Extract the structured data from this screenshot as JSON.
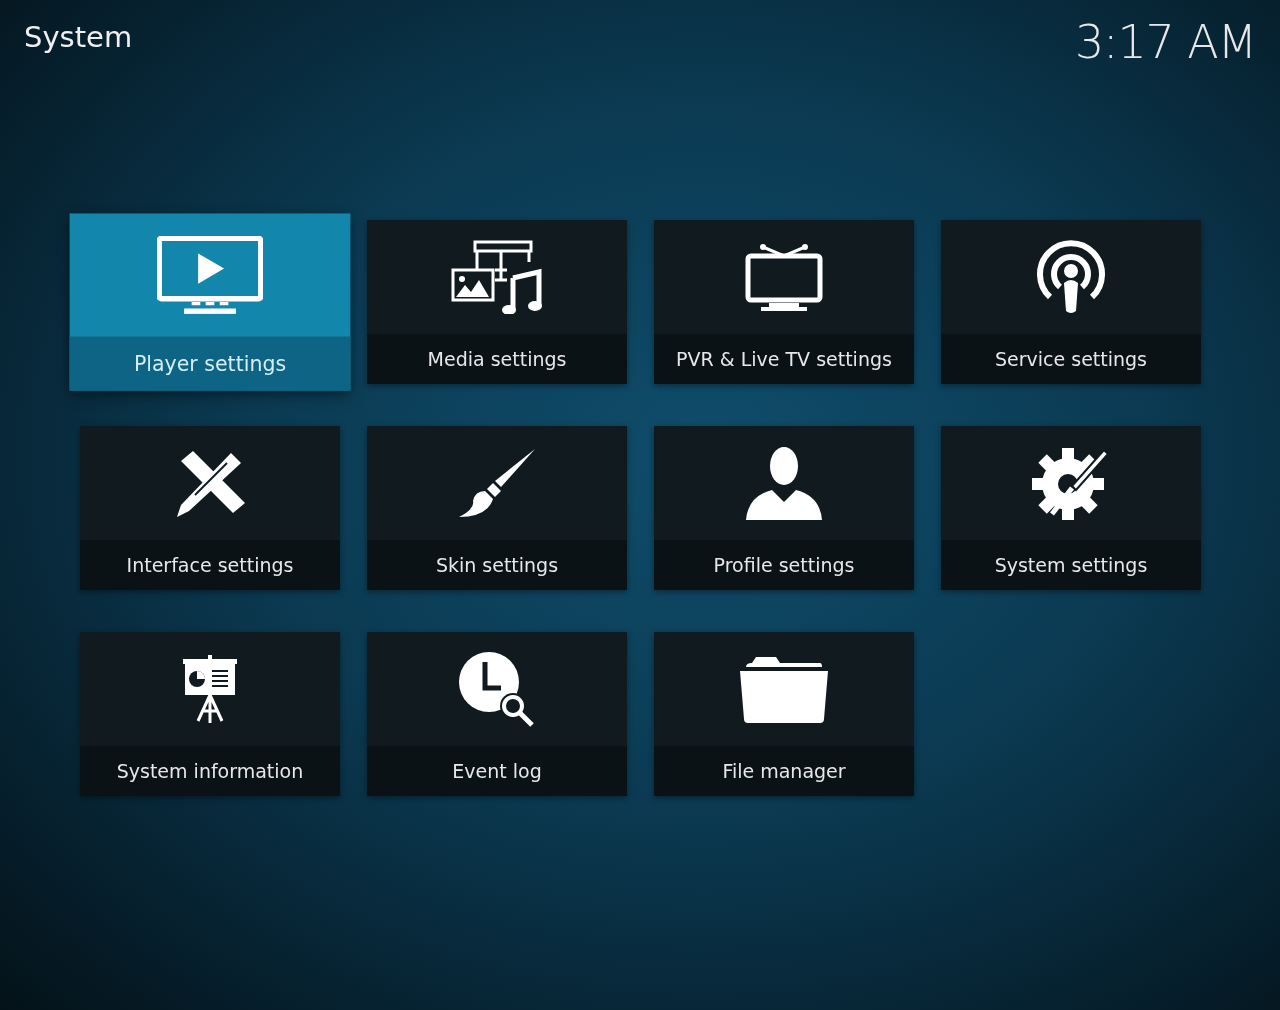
{
  "header": {
    "title": "System",
    "clock": "3:17 AM"
  },
  "tiles": [
    {
      "label": "Player settings",
      "kind": "player",
      "selected": true
    },
    {
      "label": "Media settings",
      "kind": "media",
      "selected": false
    },
    {
      "label": "PVR & Live TV settings",
      "kind": "tv",
      "selected": false
    },
    {
      "label": "Service settings",
      "kind": "service",
      "selected": false
    },
    {
      "label": "Interface settings",
      "kind": "interface",
      "selected": false
    },
    {
      "label": "Skin settings",
      "kind": "skin",
      "selected": false
    },
    {
      "label": "Profile settings",
      "kind": "profile",
      "selected": false
    },
    {
      "label": "System settings",
      "kind": "system",
      "selected": false
    },
    {
      "label": "System information",
      "kind": "info",
      "selected": false
    },
    {
      "label": "Event log",
      "kind": "log",
      "selected": false
    },
    {
      "label": "File manager",
      "kind": "files",
      "selected": false
    }
  ]
}
